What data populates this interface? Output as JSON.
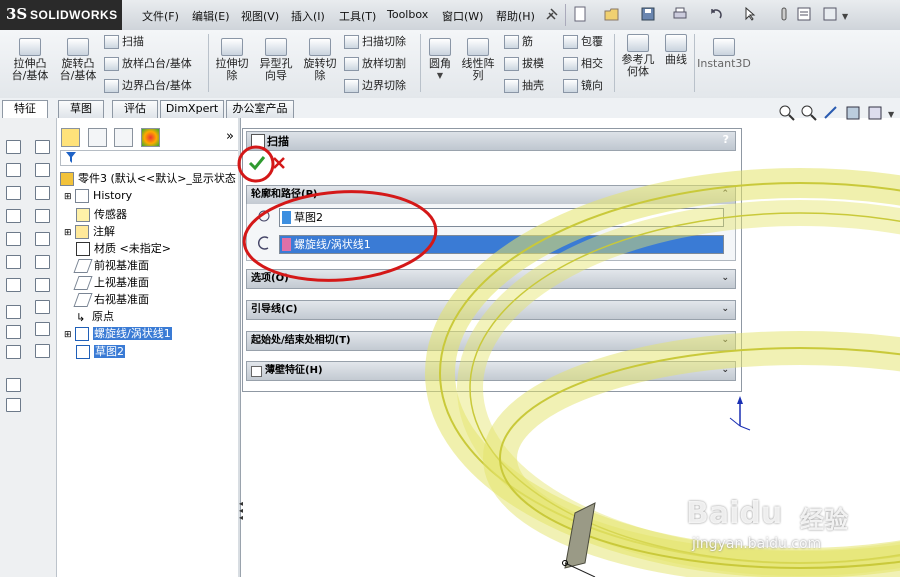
{
  "app": {
    "logo_mark": "3S",
    "logo_text": "SOLIDWORKS"
  },
  "menu": [
    "文件(F)",
    "编辑(E)",
    "视图(V)",
    "插入(I)",
    "工具(T)",
    "Toolbox",
    "窗口(W)",
    "帮助(H)"
  ],
  "ribbon": {
    "big": [
      {
        "label1": "拉伸凸",
        "label2": "台/基体"
      },
      {
        "label1": "旋转凸",
        "label2": "台/基体"
      },
      {
        "label1": "拉伸切",
        "label2": "除"
      },
      {
        "label1": "异型孔",
        "label2": "向导"
      },
      {
        "label1": "旋转切",
        "label2": "除"
      },
      {
        "label1": "圆角",
        "label2": ""
      },
      {
        "label1": "线性阵",
        "label2": "列"
      },
      {
        "label1": "参考几",
        "label2": "何体"
      },
      {
        "label1": "曲线",
        "label2": ""
      },
      {
        "label1": "Instant3D",
        "label2": ""
      }
    ],
    "small": [
      "扫描",
      "放样凸台/基体",
      "边界凸台/基体",
      "扫描切除",
      "放样切割",
      "边界切除",
      "筋",
      "拔模",
      "抽壳",
      "包覆",
      "相交",
      "镜向"
    ]
  },
  "tabs": [
    "特征",
    "草图",
    "评估",
    "DimXpert",
    "办公室产品"
  ],
  "tree": {
    "root": "零件3 (默认<<默认>_显示状态",
    "items": [
      "History",
      "传感器",
      "注解",
      "材质 <未指定>",
      "前视基准面",
      "上视基准面",
      "右视基准面",
      "原点",
      "螺旋线/涡状线1",
      "草图2"
    ],
    "collapse_glyph": "»"
  },
  "property_manager": {
    "title": "扫描",
    "help": "?",
    "sections": [
      {
        "label": "轮廓和路径(P)",
        "chevron": "⌃"
      },
      {
        "label": "选项(O)",
        "chevron": "⌄"
      },
      {
        "label": "引导线(C)",
        "chevron": "⌄"
      },
      {
        "label": "起始处/结束处相切(T)",
        "chevron": "⌄"
      },
      {
        "label": "薄壁特征(H)",
        "chevron": "⌄"
      }
    ],
    "profile_field": "草图2",
    "path_field": "螺旋线/涡状线1",
    "profile_color": "#3d8fe0",
    "path_color": "#e070a8"
  },
  "watermark": {
    "line1": "Baidu",
    "line2": "经验",
    "url": "jingyan.baidu.com"
  },
  "colors": {
    "annotation_red": "#d41818",
    "selection_blue": "#3a7bd5",
    "part_yellow": "#e4e46a"
  }
}
